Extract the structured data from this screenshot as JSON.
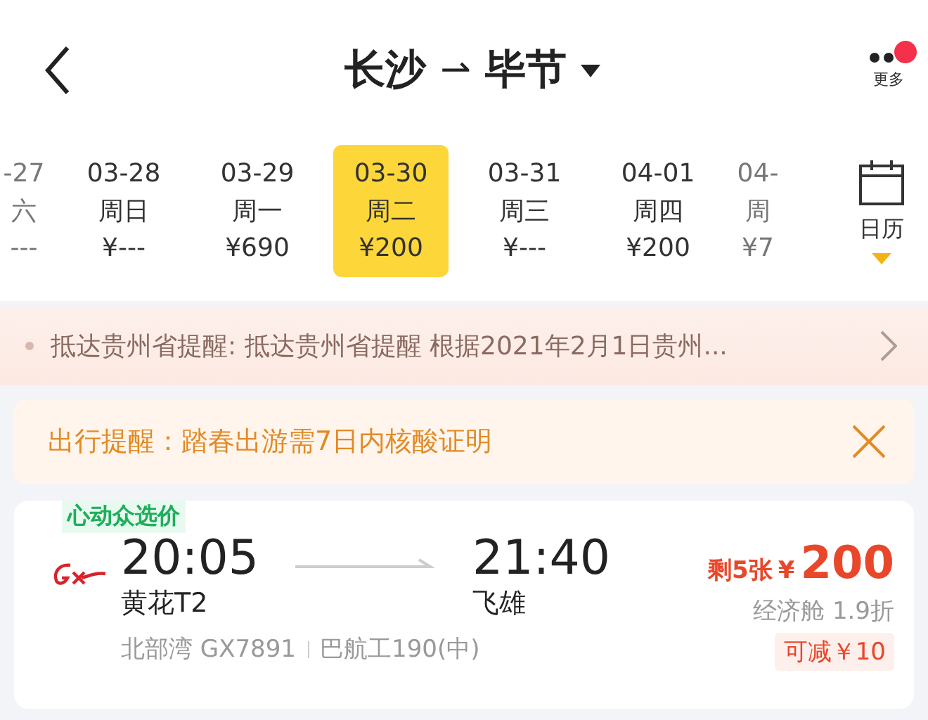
{
  "header": {
    "from": "长沙",
    "arrow": "⇀",
    "to": "毕节",
    "more_label": "更多",
    "has_notification": true
  },
  "dates": [
    {
      "date": "-27",
      "weekday": "六",
      "price": "---",
      "selected": false,
      "partial": true
    },
    {
      "date": "03-28",
      "weekday": "周日",
      "price": "¥---",
      "selected": false
    },
    {
      "date": "03-29",
      "weekday": "周一",
      "price": "¥690",
      "selected": false
    },
    {
      "date": "03-30",
      "weekday": "周二",
      "price": "¥200",
      "selected": true
    },
    {
      "date": "03-31",
      "weekday": "周三",
      "price": "¥---",
      "selected": false
    },
    {
      "date": "04-01",
      "weekday": "周四",
      "price": "¥200",
      "selected": false
    },
    {
      "date": "04-",
      "weekday": "周",
      "price": "¥7",
      "selected": false,
      "partial": true
    }
  ],
  "calendar_label": "日历",
  "notice": "抵达贵州省提醒: 抵达贵州省提醒 根据2021年2月1日贵州...",
  "reminder": "出行提醒：踏春出游需7日内核酸证明",
  "flight": {
    "tag": "心动众选价",
    "depart_time": "20:05",
    "depart_airport": "黄花T2",
    "arrive_time": "21:40",
    "arrive_airport": "飞雄",
    "airline": "北部湾 GX7891",
    "aircraft": "巴航工190(中)",
    "seats_left": "剩5张",
    "currency": "¥",
    "price": "200",
    "cabin": "经济舱 1.9折",
    "discount": "可减￥10"
  }
}
